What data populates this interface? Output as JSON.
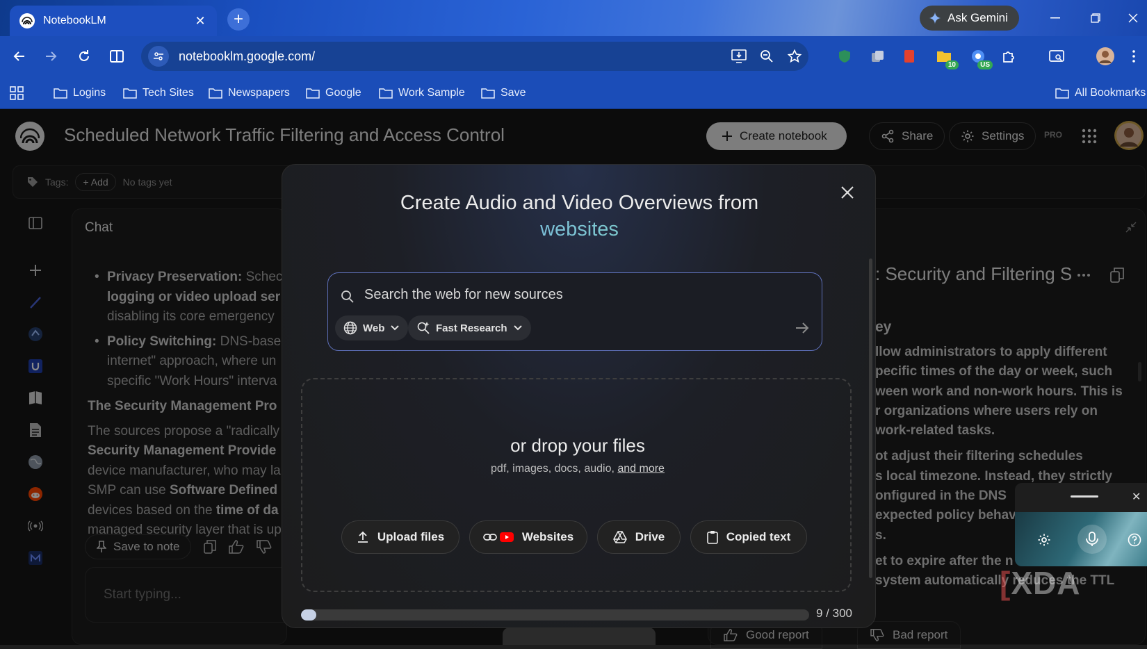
{
  "browser": {
    "tab_title": "NotebookLM",
    "tab_close": "✕",
    "new_tab": "+",
    "ask_gemini": "Ask Gemini",
    "url": "notebooklm.google.com/",
    "extension_badges": [
      "10",
      "US"
    ],
    "bookmarks": [
      "Logins",
      "Tech Sites",
      "Newspapers",
      "Google",
      "Work Sample",
      "Save"
    ],
    "all_bookmarks": "All Bookmarks"
  },
  "header": {
    "title": "Scheduled Network Traffic Filtering and Access Control",
    "create_notebook": "Create notebook",
    "share": "Share",
    "settings": "Settings",
    "pro": "PRO"
  },
  "tags": {
    "label": "Tags:",
    "add": "+ Add",
    "empty": "No tags yet"
  },
  "chat": {
    "title": "Chat",
    "lines": [
      {
        "bullet": true,
        "bold": "Privacy Preservation:",
        "text": " Schec"
      },
      {
        "bullet": false,
        "bold": "logging or video upload ser",
        "text": "",
        "indent": true
      },
      {
        "bullet": false,
        "bold": "",
        "text": "disabling its core emergency",
        "indent": true
      },
      {
        "bullet": true,
        "bold": "Policy Switching:",
        "text": " DNS-base"
      },
      {
        "bullet": false,
        "bold": "",
        "text": "internet\" approach, where un",
        "indent": true
      },
      {
        "bullet": false,
        "bold": "",
        "text": "specific \"Work Hours\" interva",
        "indent": true
      }
    ],
    "heading": "The Security Management Pro",
    "para": [
      {
        "pre": "The sources propose a \"radically",
        "bold": "",
        "post": ""
      },
      {
        "pre": "",
        "bold": "Security Management Provide",
        "post": ""
      },
      {
        "pre": "device manufacturer, who may la",
        "bold": "",
        "post": ""
      },
      {
        "pre": "SMP can use ",
        "bold": "Software Defined",
        "post": ""
      },
      {
        "pre": "devices based on the ",
        "bold": "time of da",
        "post": ""
      },
      {
        "pre": "managed security layer that is up",
        "bold": "",
        "post": ""
      }
    ],
    "save_to_note": "Save to note",
    "input_placeholder": "Start typing..."
  },
  "studio": {
    "report_title": ": Security and Filtering S",
    "report_subheading": "ey",
    "lines": [
      "llow administrators to apply different",
      "pecific times of the day or week, such",
      "ween work and non-work hours. This is",
      "r organizations where users rely on",
      "work-related tasks.",
      "",
      "ot adjust their filtering schedules",
      "s local timezone. Instead, they strictly",
      "onfigured in the DNS",
      "expected policy behav",
      "s.",
      "",
      "et to expire after the n",
      "system automatically reduces the TTL"
    ],
    "good_report": "Good report",
    "bad_report": "Bad report"
  },
  "modal": {
    "title_line1": "Create Audio and Video Overviews from",
    "title_accent": "websites",
    "search_placeholder": "Search the web for new sources",
    "chip_web": "Web",
    "chip_research": "Fast Research",
    "drop_title": "or drop your files",
    "drop_sub": "pdf, images, docs, audio, ",
    "drop_more": "and more",
    "buttons": {
      "upload": "Upload files",
      "websites": "Websites",
      "drive": "Drive",
      "copied": "Copied text"
    },
    "source_limit_label": "9 / 300",
    "source_count": 9,
    "source_max": 300
  },
  "watermark": "XDA",
  "colors": {
    "accent_blue": "#7aa7ff",
    "accent_green": "#7ee0a6",
    "chrome_blue": "#1b4db8"
  }
}
